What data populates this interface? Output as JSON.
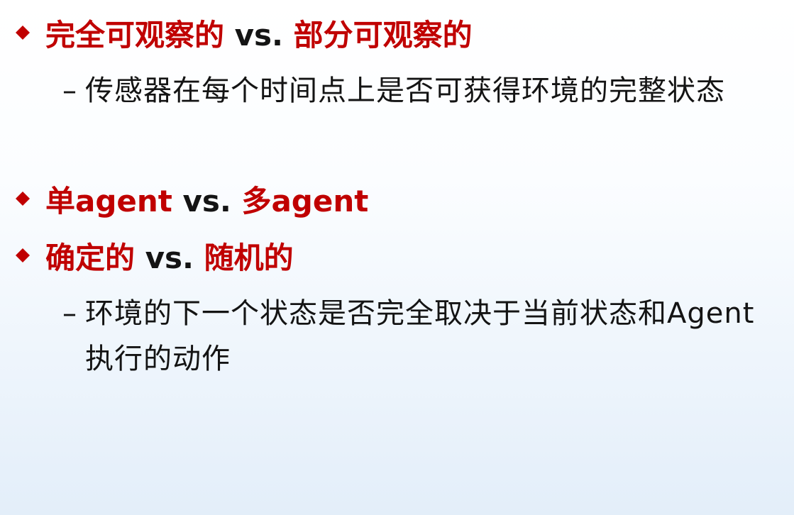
{
  "bullets": [
    {
      "left_term": "完全可观察的",
      "vs": " vs. ",
      "right_term": "部分可观察的",
      "sub": {
        "dash": "–",
        "text": "传感器在每个时间点上是否可获得环境的完整状态"
      }
    },
    {
      "left_term": "单agent",
      "vs": " vs. ",
      "right_term": "多agent"
    },
    {
      "left_term": "确定的",
      "vs": " vs. ",
      "right_term": "随机的",
      "sub": {
        "dash": "–",
        "text": "环境的下一个状态是否完全取决于当前状态和Agent执行的动作"
      }
    }
  ],
  "colors": {
    "accent": "#c00000",
    "text": "#141414",
    "bullet_icon": "#c00000"
  },
  "icons": {
    "bullet": "red-diamond-icon"
  }
}
